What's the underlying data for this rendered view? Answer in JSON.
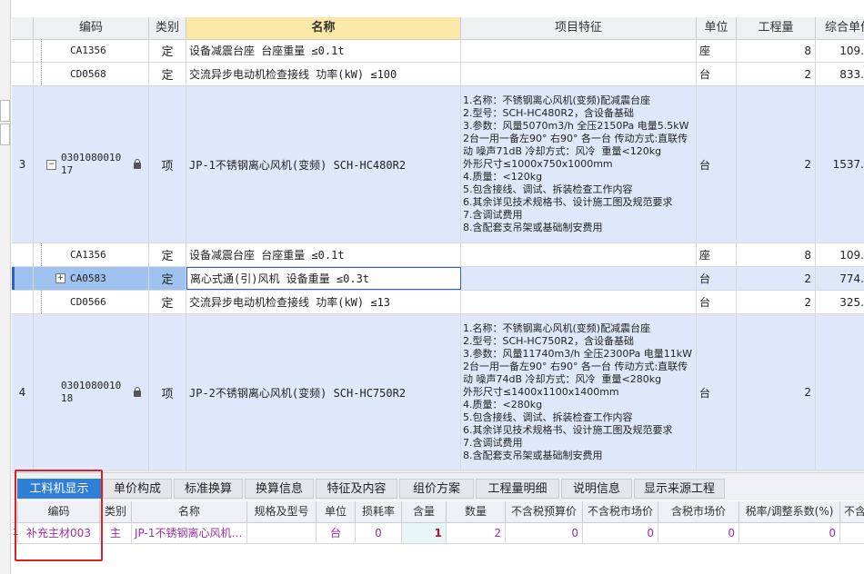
{
  "header": {
    "code": "编码",
    "type": "类别",
    "name": "名称",
    "feature": "项目特征",
    "unit": "单位",
    "qty": "工程量",
    "price": "综合单价"
  },
  "rows": [
    {
      "num": "",
      "code": "CA1356",
      "type": "定",
      "name": "设备减震台座 台座重量 ≤0.1t",
      "feature": "",
      "unit": "座",
      "qty": "8",
      "price": "109."
    },
    {
      "num": "",
      "code": "CD0568",
      "type": "定",
      "name": "交流异步电动机检查接线 功率(kW) ≤100",
      "feature": "",
      "unit": "台",
      "qty": "2",
      "price": "833."
    },
    {
      "num": "3",
      "code": "030108001017",
      "type": "项",
      "name": "JP-1不锈钢离心风机(变频) SCH-HC480R2",
      "feature": "1.名称：不锈钢离心风机(变频)配减震台座\n2.型号：SCH-HC480R2，含设备基础\n3.参数：风量5070m3/h 全压2150Pa 电量5.5kW\n2台一用一备左90° 右90° 各一台 传动方式:直联传动 噪声71dB 冷却方式：风冷  重量<120kg\n外形尺寸≤1000x750x1000mm\n4.质量：<120kg\n5.包含接线、调试、拆装检查工作内容\n6.其余详见技术规格书、设计施工图及规范要求\n7.含调试费用\n8.含配套支吊架或基础制安费用",
      "unit": "台",
      "qty": "2",
      "price": "1537."
    },
    {
      "num": "",
      "code": "CA1356",
      "type": "定",
      "name": "设备减震台座 台座重量 ≤0.1t",
      "feature": "",
      "unit": "座",
      "qty": "8",
      "price": "109."
    },
    {
      "num": "",
      "code": "CA0583",
      "type": "定",
      "name": "离心式通(引)风机 设备重量 ≤0.3t",
      "feature": "",
      "unit": "台",
      "qty": "2",
      "price": "774."
    },
    {
      "num": "",
      "code": "CD0566",
      "type": "定",
      "name": "交流异步电动机检查接线 功率(kW) ≤13",
      "feature": "",
      "unit": "台",
      "qty": "2",
      "price": "325."
    },
    {
      "num": "4",
      "code": "030108001018",
      "type": "项",
      "name": "JP-2不锈钢离心风机(变频) SCH-HC750R2",
      "feature": "1.名称：不锈钢离心风机(变频)配减震台座\n2.型号：SCH-HC750R2，含设备基础\n3.参数：风量11740m3/h 全压2300Pa 电量11kW\n2台一用一备左90° 右90° 各一台 传动方式:直联传动 噪声74dB 冷却方式：风冷  重量<280kg\n外形尺寸≤1400x1100x1400mm\n4.质量：<280kg\n5.包含接线、调试、拆装检查工作内容\n6.其余详见技术规格书、设计施工图及规范要求\n7.含调试费用\n8.含配套支吊架或基础制安费用",
      "unit": "台",
      "qty": "2",
      "price": ""
    }
  ],
  "tabs": [
    "工料机显示",
    "单价构成",
    "标准换算",
    "换算信息",
    "特征及内容",
    "组价方案",
    "工程量明细",
    "说明信息",
    "显示来源工程"
  ],
  "bottom_header": [
    "编码",
    "类别",
    "名称",
    "规格及型号",
    "单位",
    "损耗率",
    "含量",
    "数量",
    "不含税预算价",
    "不含税市场价",
    "含税市场价",
    "税率/调整系数(%)",
    "不含"
  ],
  "bottom_row": {
    "num": "1",
    "code": "补充主材003",
    "type": "主",
    "name": "JP-1不锈钢离心风机…",
    "spec": "",
    "unit": "台",
    "loss": "0",
    "content": "1",
    "count": "2",
    "p1": "0",
    "p2": "0",
    "p3": "0",
    "tax": "0"
  },
  "colors": {
    "accent": "#2f7fd8",
    "highlight": "#fde9a7",
    "blue_row": "#dfe8fb",
    "material_text": "#9b2fa6",
    "annotation_box": "#e02020"
  }
}
